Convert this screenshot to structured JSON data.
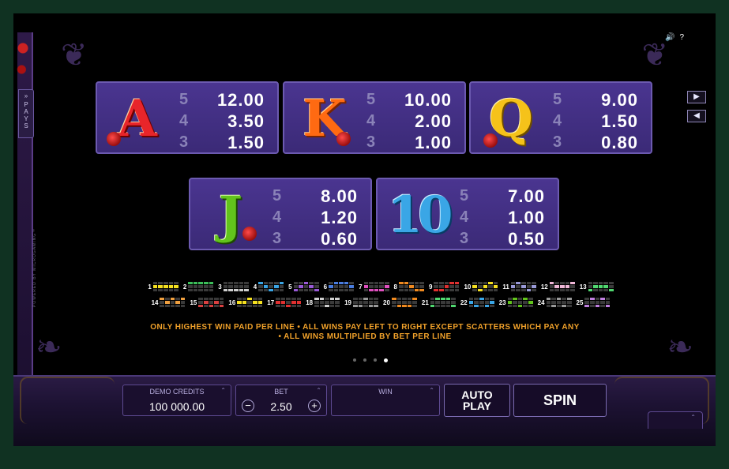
{
  "side_tab": {
    "chevron": "»",
    "label": "PAYS"
  },
  "powered_by": "POWERED BY MICROGAMING™",
  "top_icons": {
    "sound_icon": "speaker-icon",
    "help_label": "?"
  },
  "nav": {
    "next_icon": "play-right-icon",
    "prev_icon": "play-left-icon"
  },
  "pay_table": [
    {
      "symbol": "A",
      "color": "#e8252a",
      "pays": [
        {
          "count": "5",
          "value": "12.00"
        },
        {
          "count": "4",
          "value": "3.50"
        },
        {
          "count": "3",
          "value": "1.50"
        }
      ]
    },
    {
      "symbol": "K",
      "color": "#ff6a12",
      "pays": [
        {
          "count": "5",
          "value": "10.00"
        },
        {
          "count": "4",
          "value": "2.00"
        },
        {
          "count": "3",
          "value": "1.00"
        }
      ]
    },
    {
      "symbol": "Q",
      "color": "#f5c21a",
      "pays": [
        {
          "count": "5",
          "value": "9.00"
        },
        {
          "count": "4",
          "value": "1.50"
        },
        {
          "count": "3",
          "value": "0.80"
        }
      ]
    },
    {
      "symbol": "J",
      "color": "#62c41c",
      "pays": [
        {
          "count": "5",
          "value": "8.00"
        },
        {
          "count": "4",
          "value": "1.20"
        },
        {
          "count": "3",
          "value": "0.60"
        }
      ]
    },
    {
      "symbol": "10",
      "color": "#3aa6e6",
      "pays": [
        {
          "count": "5",
          "value": "7.00"
        },
        {
          "count": "4",
          "value": "1.00"
        },
        {
          "count": "3",
          "value": "0.50"
        }
      ]
    }
  ],
  "paylines": {
    "row1": [
      {
        "n": "1",
        "color": "#f5e020",
        "cells": [
          1,
          1,
          1,
          1,
          1
        ]
      },
      {
        "n": "2",
        "color": "#3cbf5a",
        "cells": [
          0,
          0,
          0,
          0,
          0
        ]
      },
      {
        "n": "3",
        "color": "#cfcfcf",
        "cells": [
          2,
          2,
          2,
          2,
          2
        ]
      },
      {
        "n": "4",
        "color": "#3aa6e6",
        "cells": [
          0,
          1,
          2,
          1,
          0
        ]
      },
      {
        "n": "5",
        "color": "#9a5ad8",
        "cells": [
          2,
          1,
          0,
          1,
          2
        ]
      },
      {
        "n": "6",
        "color": "#4a7de0",
        "cells": [
          1,
          0,
          0,
          0,
          1
        ]
      },
      {
        "n": "7",
        "color": "#e050c0",
        "cells": [
          1,
          2,
          2,
          2,
          1
        ]
      },
      {
        "n": "8",
        "color": "#f08a20",
        "cells": [
          0,
          0,
          1,
          2,
          2
        ]
      },
      {
        "n": "9",
        "color": "#e03030",
        "cells": [
          2,
          2,
          1,
          0,
          0
        ]
      },
      {
        "n": "10",
        "color": "#f5e020",
        "cells": [
          1,
          2,
          1,
          0,
          1
        ]
      },
      {
        "n": "11",
        "color": "#9a9ad8",
        "cells": [
          1,
          0,
          1,
          2,
          1
        ]
      },
      {
        "n": "12",
        "color": "#f0b8d8",
        "cells": [
          0,
          1,
          1,
          1,
          0
        ]
      },
      {
        "n": "13",
        "color": "#50d870",
        "cells": [
          2,
          1,
          1,
          1,
          2
        ]
      }
    ],
    "row2": [
      {
        "n": "14",
        "color": "#f0a040",
        "cells": [
          0,
          1,
          0,
          1,
          0
        ]
      },
      {
        "n": "15",
        "color": "#d84040",
        "cells": [
          2,
          1,
          2,
          1,
          2
        ]
      },
      {
        "n": "16",
        "color": "#f5e020",
        "cells": [
          1,
          1,
          0,
          1,
          1
        ]
      },
      {
        "n": "17",
        "color": "#e03030",
        "cells": [
          1,
          1,
          2,
          1,
          1
        ]
      },
      {
        "n": "18",
        "color": "#cfcfcf",
        "cells": [
          0,
          0,
          2,
          0,
          0
        ]
      },
      {
        "n": "19",
        "color": "#9a9a9a",
        "cells": [
          2,
          2,
          0,
          2,
          2
        ]
      },
      {
        "n": "20",
        "color": "#f08a20",
        "cells": [
          0,
          2,
          2,
          2,
          0
        ]
      },
      {
        "n": "21",
        "color": "#50d870",
        "cells": [
          2,
          0,
          0,
          0,
          2
        ]
      },
      {
        "n": "22",
        "color": "#3aa6e6",
        "cells": [
          1,
          2,
          0,
          2,
          1
        ]
      },
      {
        "n": "23",
        "color": "#62c41c",
        "cells": [
          1,
          0,
          2,
          0,
          1
        ]
      },
      {
        "n": "24",
        "color": "#9a9a9a",
        "cells": [
          0,
          2,
          0,
          2,
          0
        ]
      },
      {
        "n": "25",
        "color": "#c080e0",
        "cells": [
          2,
          0,
          2,
          0,
          2
        ]
      }
    ]
  },
  "rules": {
    "line1": "ONLY HIGHEST WIN PAID PER LINE  • ALL WINS PAY LEFT TO RIGHT EXCEPT SCATTERS WHICH PAY ANY",
    "line2": "• ALL WINS MULTIPLIED BY BET PER LINE"
  },
  "page_dots": {
    "count": 4,
    "active": 4
  },
  "bottom_bar": {
    "credits_label": "DEMO CREDITS",
    "credits_value": "100 000.00",
    "bet_label": "BET",
    "bet_value": "2.50",
    "bet_minus": "−",
    "bet_plus": "+",
    "win_label": "WIN",
    "win_value": "",
    "chevron": "⌃",
    "autoplay_line1": "AUTO",
    "autoplay_line2": "PLAY",
    "spin_label": "SPIN"
  },
  "colors": {
    "panel_purple": "#4a3590",
    "rules_orange": "#f0a12a",
    "background": "#000000"
  }
}
